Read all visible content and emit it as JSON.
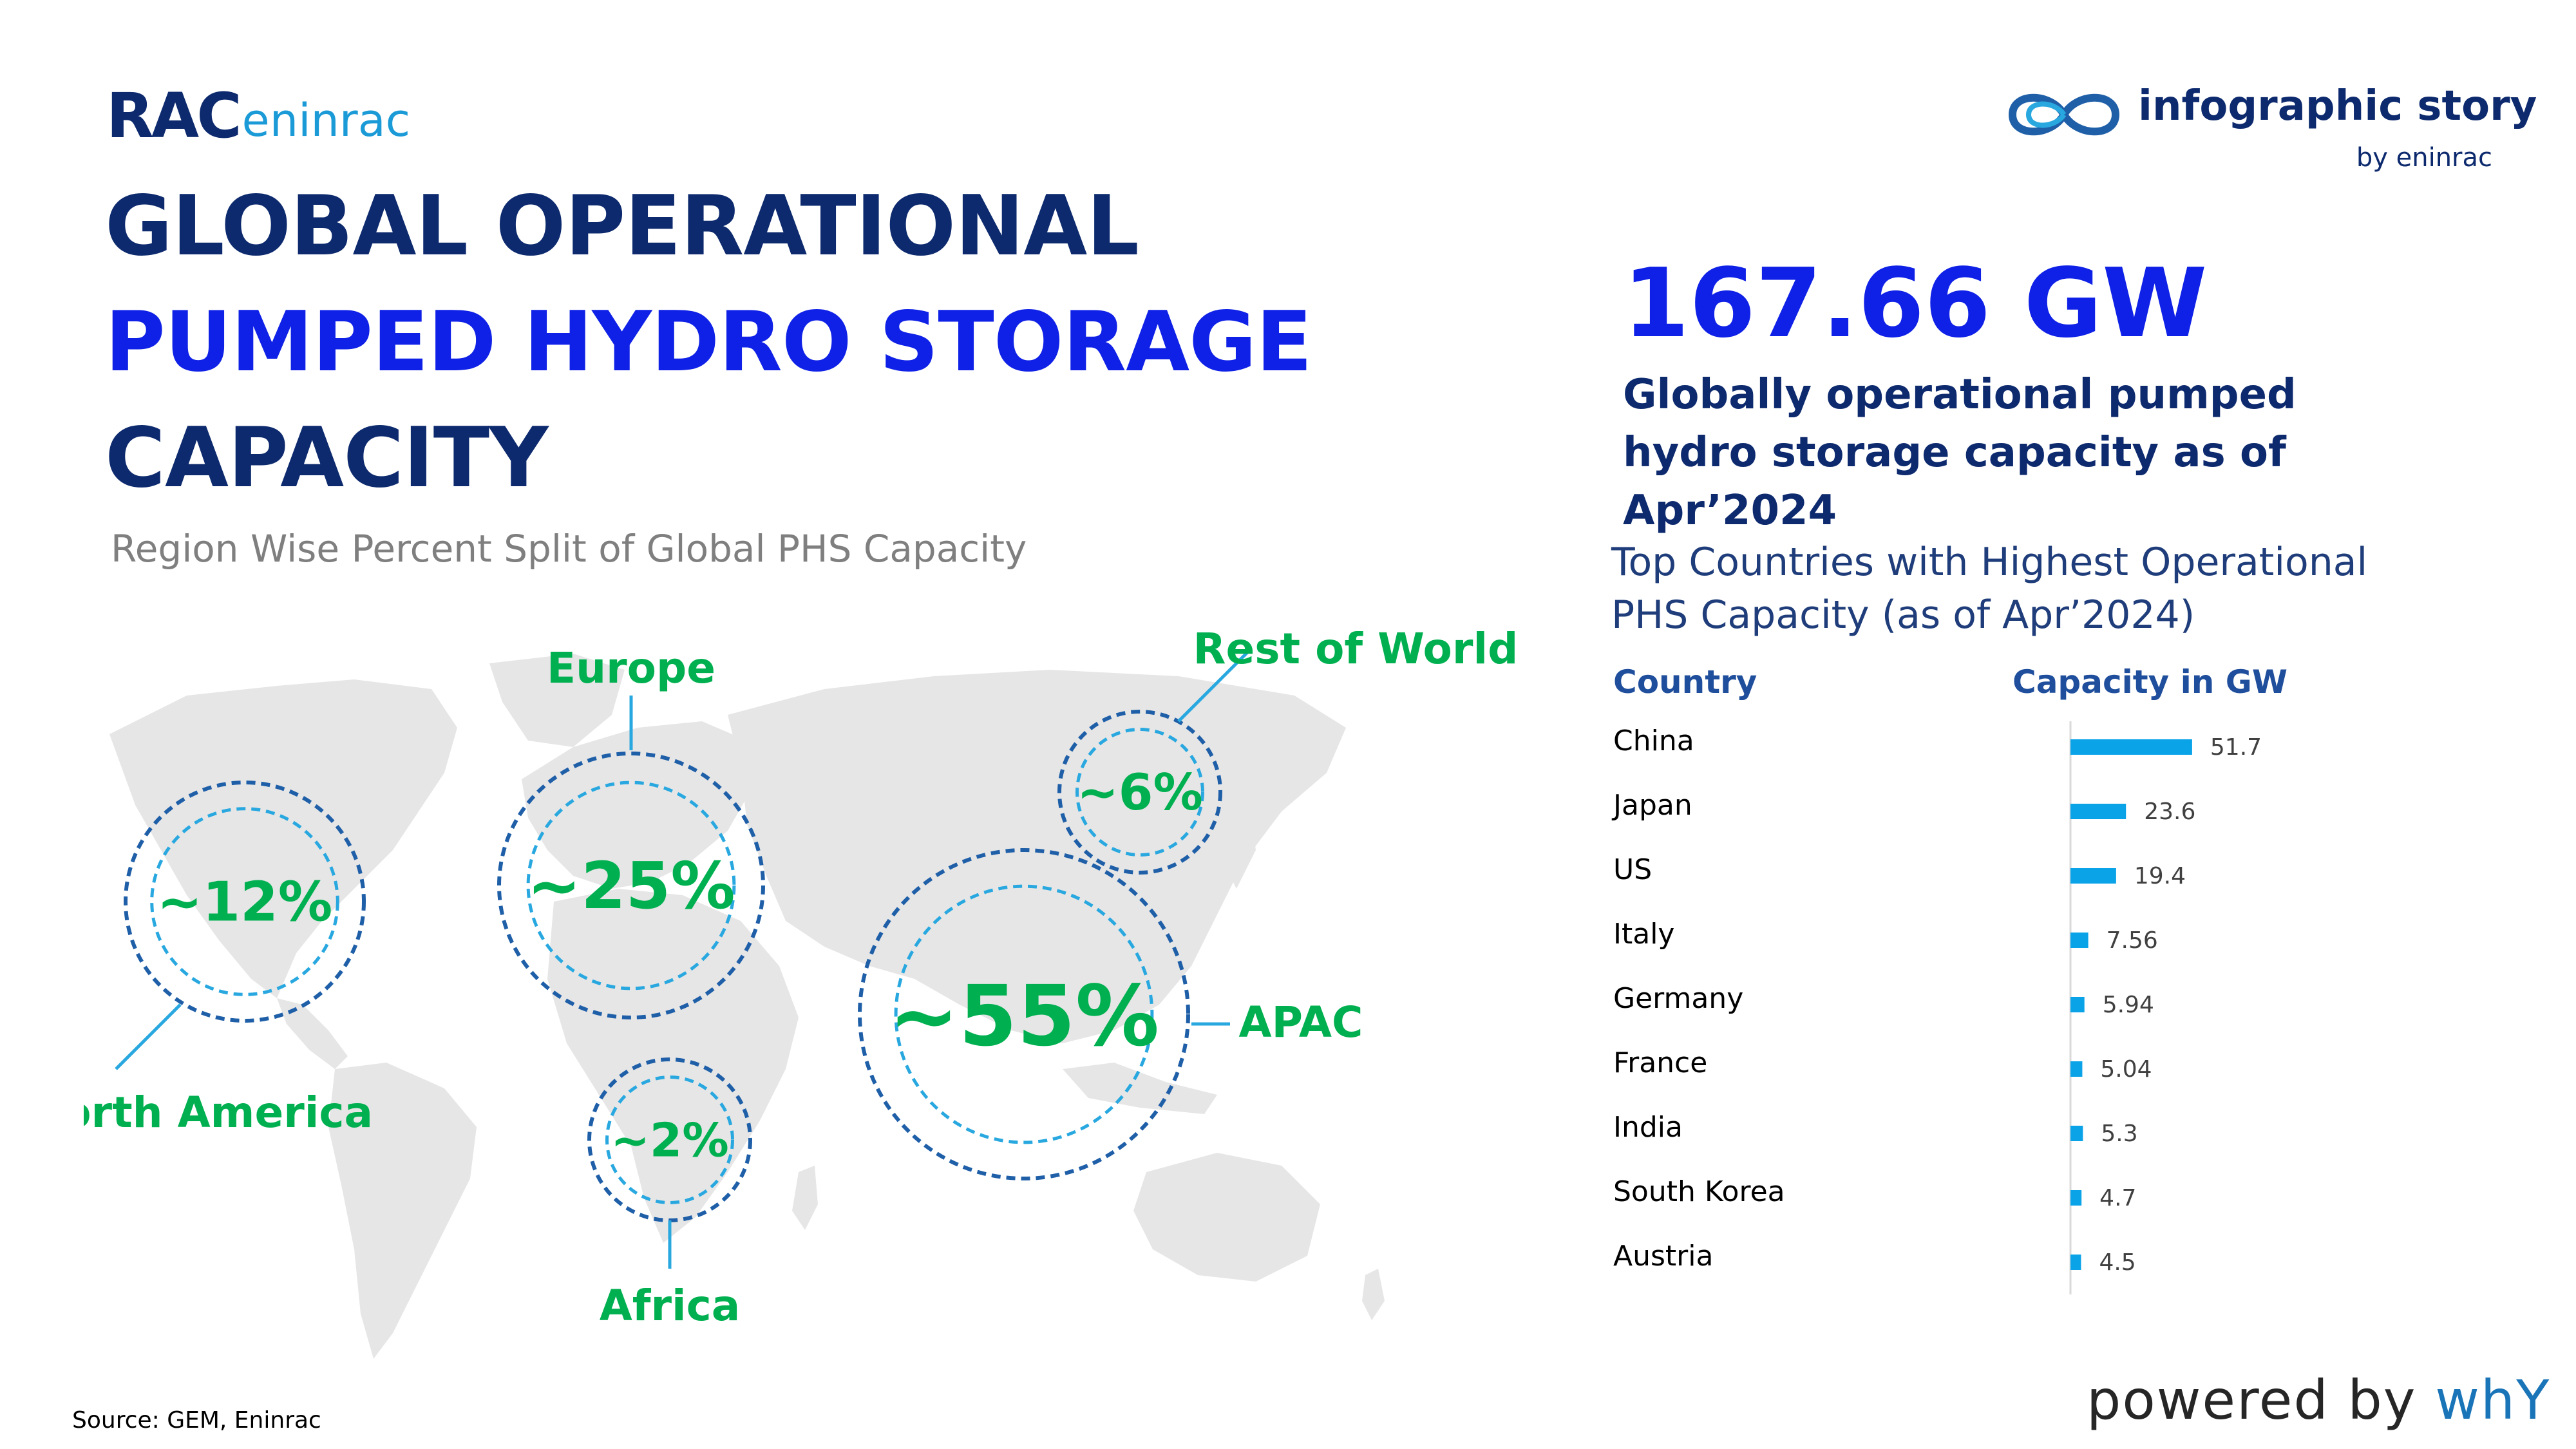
{
  "logo": {
    "mark": "RAC",
    "name": "eninrac"
  },
  "title": {
    "line1": "GLOBAL OPERATIONAL",
    "line2": "PUMPED HYDRO STORAGE",
    "line3": "CAPACITY"
  },
  "subtitle": "Region Wise Percent Split of Global PHS Capacity",
  "brand": {
    "name": "infographic story",
    "by": "by eninrac",
    "icon": "infinity-loop-icon"
  },
  "headline": {
    "value": "167.66 GW",
    "description": "Globally operational pumped hydro storage capacity as of Apr’2024"
  },
  "colors": {
    "navy": "#0d2a6e",
    "blue": "#0f21e6",
    "green": "#00b050",
    "circle_outer": "#1f5fa8",
    "circle_inner": "#29a8e0",
    "bar": "#0aa3e8",
    "map": "#e6e6e6"
  },
  "source": "Source: GEM, Eninrac",
  "powered": {
    "prefix": "powered by ",
    "brand": "whY"
  },
  "chart_data": [
    {
      "type": "bubble",
      "title": "Region Wise Percent Split of Global PHS Capacity",
      "unit": "%",
      "regions": [
        {
          "name": "North America",
          "value": 12,
          "label": "~12%"
        },
        {
          "name": "Europe",
          "value": 25,
          "label": "~25%"
        },
        {
          "name": "Rest of World",
          "value": 6,
          "label": "~6%"
        },
        {
          "name": "APAC",
          "value": 55,
          "label": "~55%"
        },
        {
          "name": "Africa",
          "value": 2,
          "label": "~2%"
        }
      ]
    },
    {
      "type": "bar",
      "orientation": "horizontal",
      "title": "Top Countries with Highest Operational PHS Capacity (as of Apr’2024)",
      "column_headers": [
        "Country",
        "Capacity in GW"
      ],
      "categories": [
        "China",
        "Japan",
        "US",
        "Italy",
        "Germany",
        "France",
        "India",
        "South Korea",
        "Austria"
      ],
      "values": [
        51.7,
        23.6,
        19.4,
        7.56,
        5.94,
        5.04,
        5.3,
        4.7,
        4.5
      ],
      "labels": [
        "51.7",
        "23.6",
        "19.4",
        "7.56",
        "5.94",
        "5.04",
        "5.3",
        "4.7",
        "4.5"
      ],
      "xlim": [
        0,
        52
      ]
    }
  ]
}
